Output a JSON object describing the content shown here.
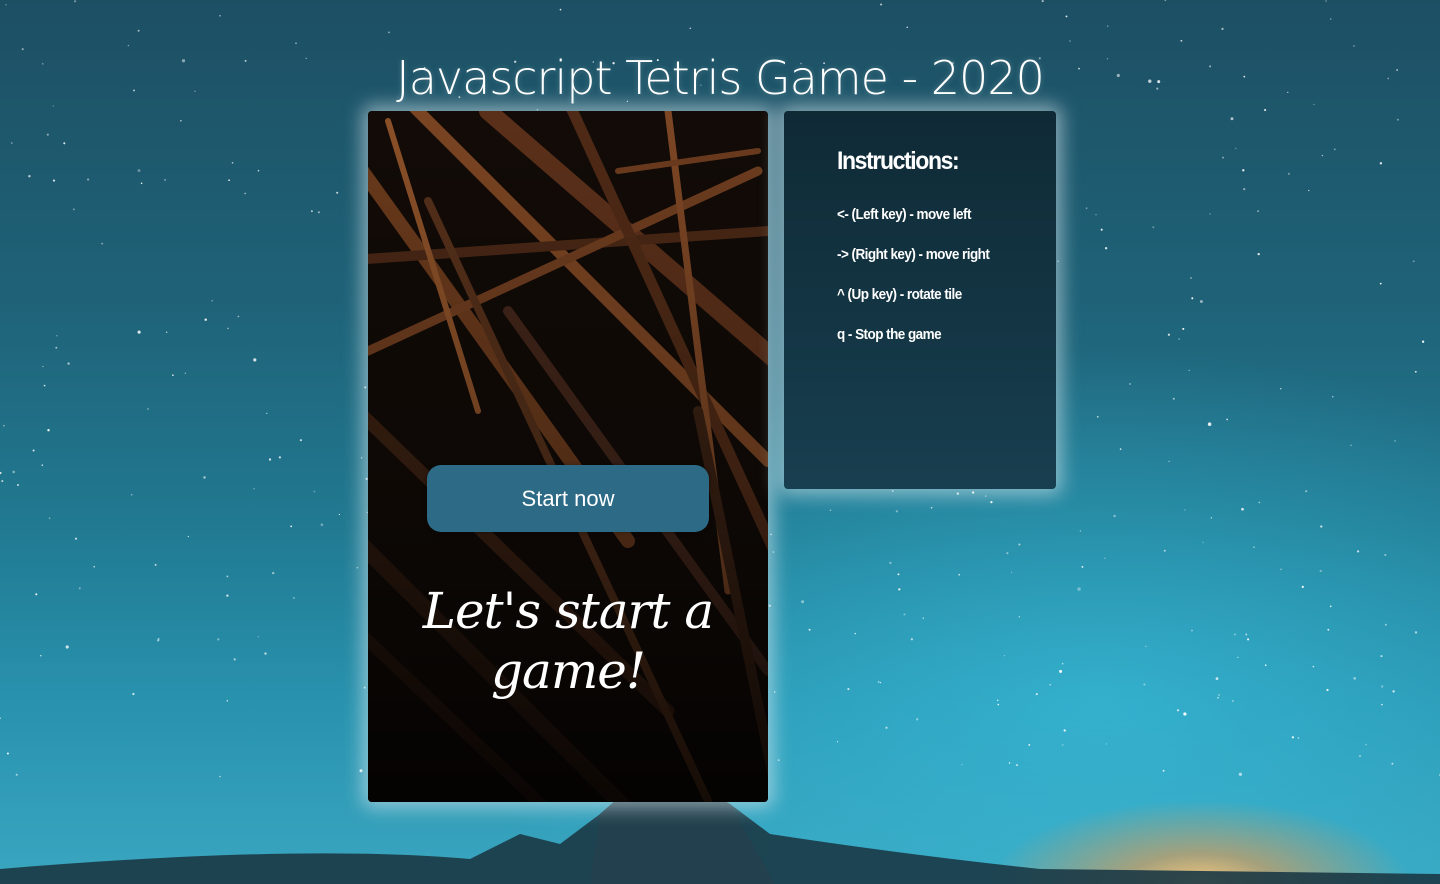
{
  "page": {
    "title": "Javascript Tetris Game - 2020"
  },
  "game": {
    "start_button_label": "Start now",
    "start_message": "Let's start a game!"
  },
  "instructions": {
    "heading": "Instructions:",
    "items": [
      "<- (Left key) - move left",
      "-> (Right key) - move right",
      "^ (Up key) - rotate tile",
      "q - Stop the game"
    ]
  },
  "colors": {
    "sky": "#1f6379",
    "button": "#2c6a86",
    "panel": "#143645",
    "glow": "#dcebf0"
  }
}
